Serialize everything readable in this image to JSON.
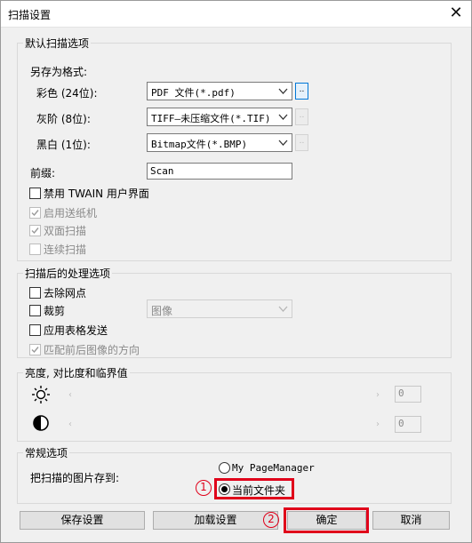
{
  "window": {
    "title": "扫描设置",
    "close_glyph": "✕"
  },
  "defaults_group": {
    "label": "默认扫描选项",
    "save_as_format_label": "另存为格式:",
    "formats": [
      {
        "label": "彩色 (24位):",
        "value": "PDF 文件(*.pdf)"
      },
      {
        "label": "灰阶 (8位):",
        "value": "TIFF—未压缩文件(*.TIF)"
      },
      {
        "label": "黑白 (1位):",
        "value": "Bitmap文件(*.BMP)"
      }
    ],
    "dots_label": "..",
    "prefix_label": "前缀:",
    "prefix_value": "Scan",
    "options": [
      {
        "label": "禁用 TWAIN 用户界面",
        "checked": false,
        "disabled": false
      },
      {
        "label": "启用送纸机",
        "checked": true,
        "disabled": true
      },
      {
        "label": "双面扫描",
        "checked": true,
        "disabled": true
      },
      {
        "label": "连续扫描",
        "checked": false,
        "disabled": true
      }
    ]
  },
  "post_group": {
    "label": "扫描后的处理选项",
    "despeckle_label": "去除网点",
    "crop_label": "裁剪",
    "crop_select_value": "图像",
    "apply_form_label": "应用表格发送",
    "match_orientation_label": "匹配前后图像的方向"
  },
  "adjust_group": {
    "label": "亮度, 对比度和临界值",
    "brightness_icon": "sun-icon",
    "contrast_icon": "contrast-icon",
    "brightness_value": "0",
    "contrast_value": "0"
  },
  "general_group": {
    "label": "常规选项",
    "save_to_label": "把扫描的图片存到:",
    "option_my_pagemanager": "My PageManager",
    "option_current_folder": "当前文件夹",
    "selected": "当前文件夹"
  },
  "buttons": {
    "save_settings": "保存设置",
    "load_settings": "加载设置",
    "ok": "确定",
    "cancel": "取消"
  },
  "annotations": {
    "step1": "1",
    "step2": "2",
    "color": "#e0001a"
  }
}
